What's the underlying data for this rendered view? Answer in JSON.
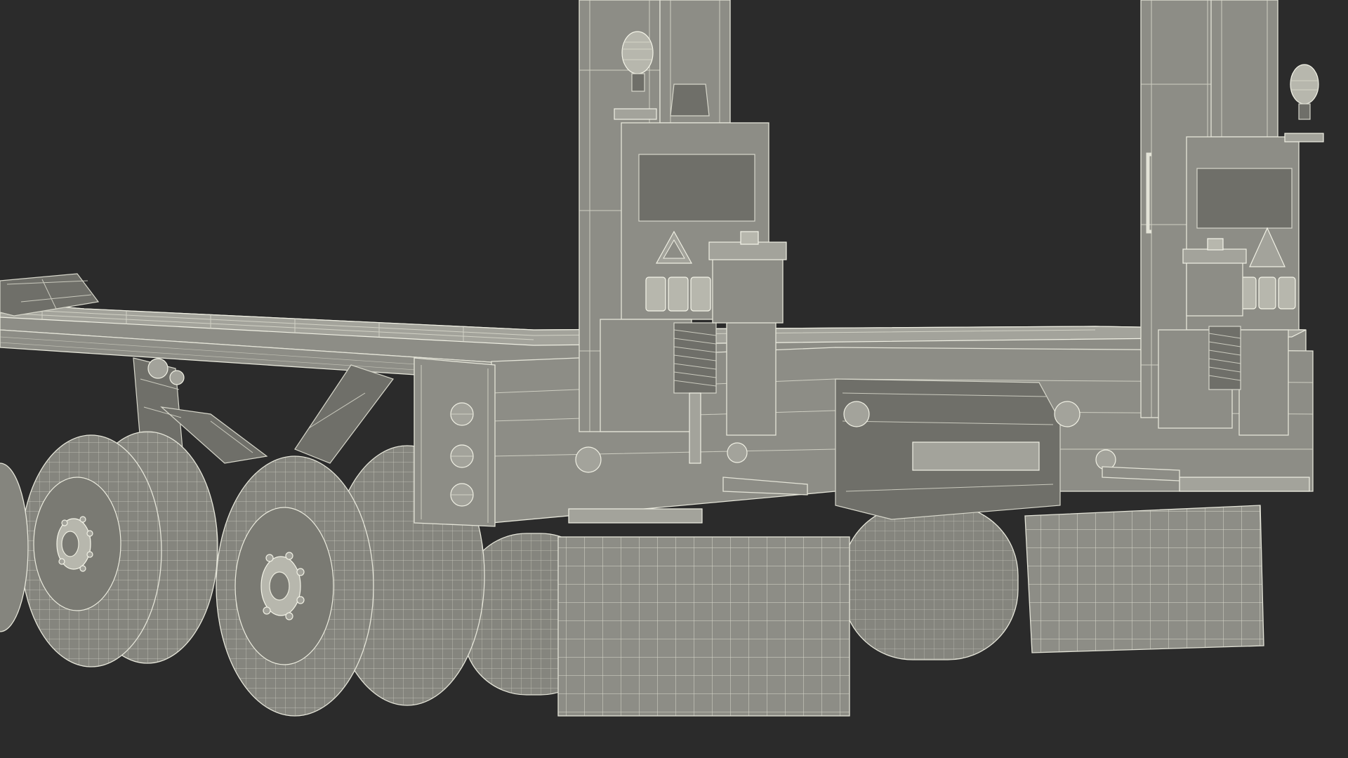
{
  "scene": {
    "subject": "lowboy-trailer-wireframe-render",
    "colors": {
      "background": "#2b2b2b",
      "model": "#8d8d86",
      "wireframe": "#e4e4d8"
    },
    "counts": {
      "visible_wheels": 5,
      "rear_posts": 2,
      "mudflaps": 2
    }
  }
}
